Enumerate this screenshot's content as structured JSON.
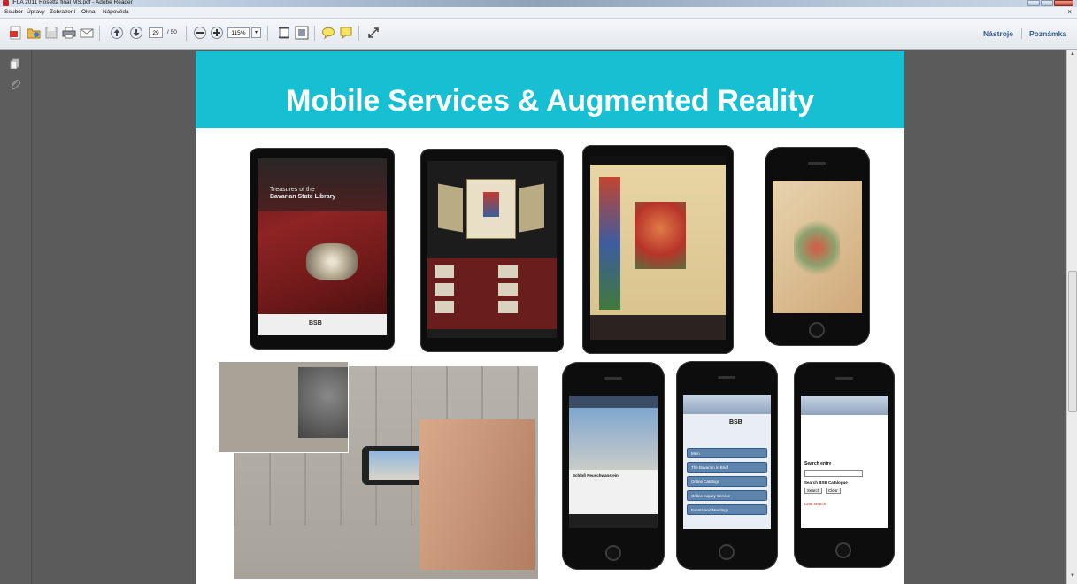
{
  "window": {
    "title": "IFLA 2011 Rosetta final MS.pdf - Adobe Reader"
  },
  "menu": [
    "Soubor",
    "Úpravy",
    "Zobrazení",
    "Okna",
    "Nápověda"
  ],
  "toolbar": {
    "current_page": "29",
    "total_pages": "/ 50",
    "zoom": "115%",
    "tools_label": "Nástroje",
    "comment_label": "Poznámka"
  },
  "slide": {
    "title": "Mobile Services & Augmented Reality",
    "header_color": "#16bfd2",
    "ipad1": {
      "heading_line1": "Treasures of the",
      "heading_line2": "Bavarian State Library",
      "logo": "BSB"
    },
    "phone_app": {
      "item": "Schloß Neuschwanstein"
    },
    "phone_web": {
      "logo": "BSB",
      "menu": [
        "Mein",
        "The Bavarian in Brief",
        "Online Catalogs",
        "Online Inquiry Service",
        "Events and Meetings"
      ]
    },
    "phone_search": {
      "heading": "Search entry",
      "sub": "Search BSB Catalogue",
      "buttons": [
        "Search",
        "Clear"
      ],
      "link": "Limit search"
    }
  }
}
